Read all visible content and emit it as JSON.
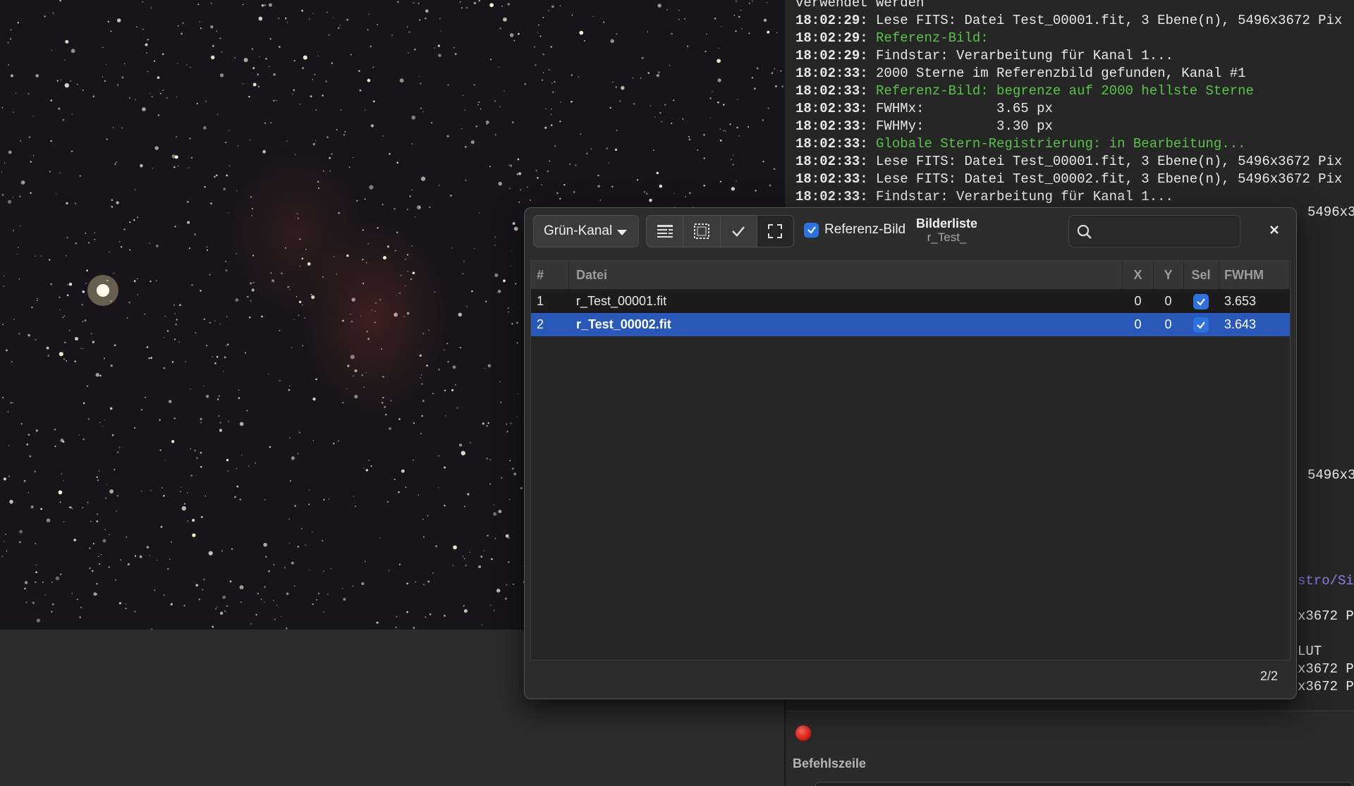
{
  "console": {
    "lines": [
      {
        "time": "",
        "text": "verwendet werden",
        "status": "normal"
      },
      {
        "time": "18:02:29:",
        "text": "Lese FITS: Datei Test_00001.fit, 3 Ebene(n), 5496x3672 Pix",
        "status": "normal"
      },
      {
        "time": "18:02:29:",
        "text": "Referenz-Bild:",
        "status": "ok"
      },
      {
        "time": "18:02:29:",
        "text": "Findstar: Verarbeitung für Kanal 1...",
        "status": "normal"
      },
      {
        "time": "18:02:33:",
        "text": "2000 Sterne im Referenzbild gefunden, Kanal #1",
        "status": "normal"
      },
      {
        "time": "18:02:33:",
        "text": "Referenz-Bild: begrenze auf 2000 hellste Sterne",
        "status": "ok"
      },
      {
        "time": "18:02:33:",
        "text": "FWHMx:         3.65 px",
        "status": "normal"
      },
      {
        "time": "18:02:33:",
        "text": "FWHMy:         3.30 px",
        "status": "normal"
      },
      {
        "time": "18:02:33:",
        "text": "Globale Stern-Registrierung: in Bearbeitung...",
        "status": "ok"
      },
      {
        "time": "18:02:33:",
        "text": "Lese FITS: Datei Test_00001.fit, 3 Ebene(n), 5496x3672 Pix",
        "status": "normal"
      },
      {
        "time": "18:02:33:",
        "text": "Lese FITS: Datei Test_00002.fit, 3 Ebene(n), 5496x3672 Pix",
        "status": "normal"
      },
      {
        "time": "18:02:33:",
        "text": "Findstar: Verarbeitung für Kanal 1...",
        "status": "normal"
      }
    ],
    "fragments": {
      "f1": "5496x3",
      "f2": "5496x3",
      "f3": "stro/Si",
      "f4": "x3672 P",
      "f5": "LUT",
      "f6": "x3672 P",
      "f7": "x3672 P"
    },
    "cmd_label": "Befehlszeile"
  },
  "dialog": {
    "channel": "Grün-Kanal",
    "reference_label": "Referenz-Bild",
    "reference_checked": true,
    "title": "Bilderliste",
    "subtitle": "r_Test_",
    "search_placeholder": "",
    "columns": [
      "#",
      "Datei",
      "X",
      "Y",
      "Sel",
      "FWHM"
    ],
    "rows": [
      {
        "num": "1",
        "file": "r_Test_00001.fit",
        "x": "0",
        "y": "0",
        "sel": true,
        "fwhm": "3.653"
      },
      {
        "num": "2",
        "file": "r_Test_00002.fit",
        "x": "0",
        "y": "0",
        "sel": true,
        "fwhm": "3.643"
      }
    ],
    "count": "2/2"
  },
  "colors": {
    "accent": "#2f72de",
    "selected_row": "#2a58b8",
    "log_ok": "#5ac24a",
    "log_link": "#8c7ff0",
    "record": "#d21b10"
  }
}
